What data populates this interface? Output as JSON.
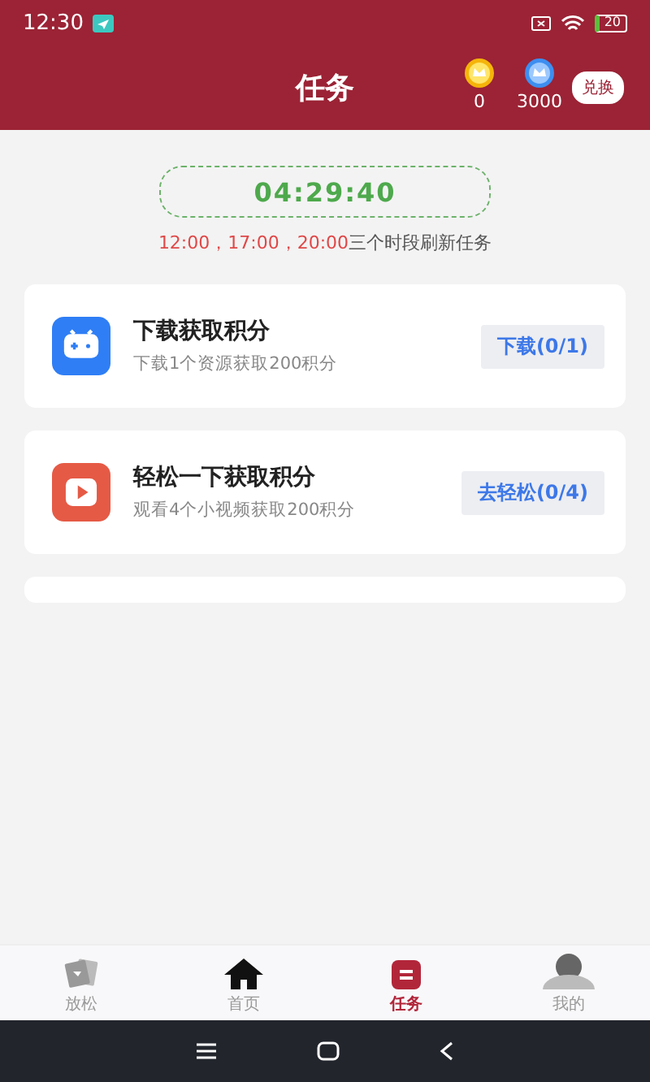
{
  "status_bar": {
    "time": "12:30",
    "battery": "20"
  },
  "header": {
    "title": "任务",
    "balances": [
      {
        "kind": "gold",
        "amount": "0"
      },
      {
        "kind": "blue",
        "amount": "3000"
      }
    ],
    "exchange_button": "兑换"
  },
  "timer": {
    "countdown": "04:29:40",
    "schedule_times": "12:00，17:00，20:00",
    "schedule_text": "三个时段刷新任务"
  },
  "tasks": [
    {
      "kind": "game",
      "title": "下载获取积分",
      "description": "下载1个资源获取200积分",
      "action": "下载(0/1)"
    },
    {
      "kind": "video",
      "title": "轻松一下获取积分",
      "description": "观看4个小视频获取200积分",
      "action": "去轻松(0/4)"
    }
  ],
  "tab_bar": [
    {
      "kind": "relax",
      "label": "放松",
      "selected": false
    },
    {
      "kind": "home",
      "label": "首页",
      "selected": false
    },
    {
      "kind": "task",
      "label": "任务",
      "selected": true
    },
    {
      "kind": "profile",
      "label": "我的",
      "selected": false
    }
  ]
}
